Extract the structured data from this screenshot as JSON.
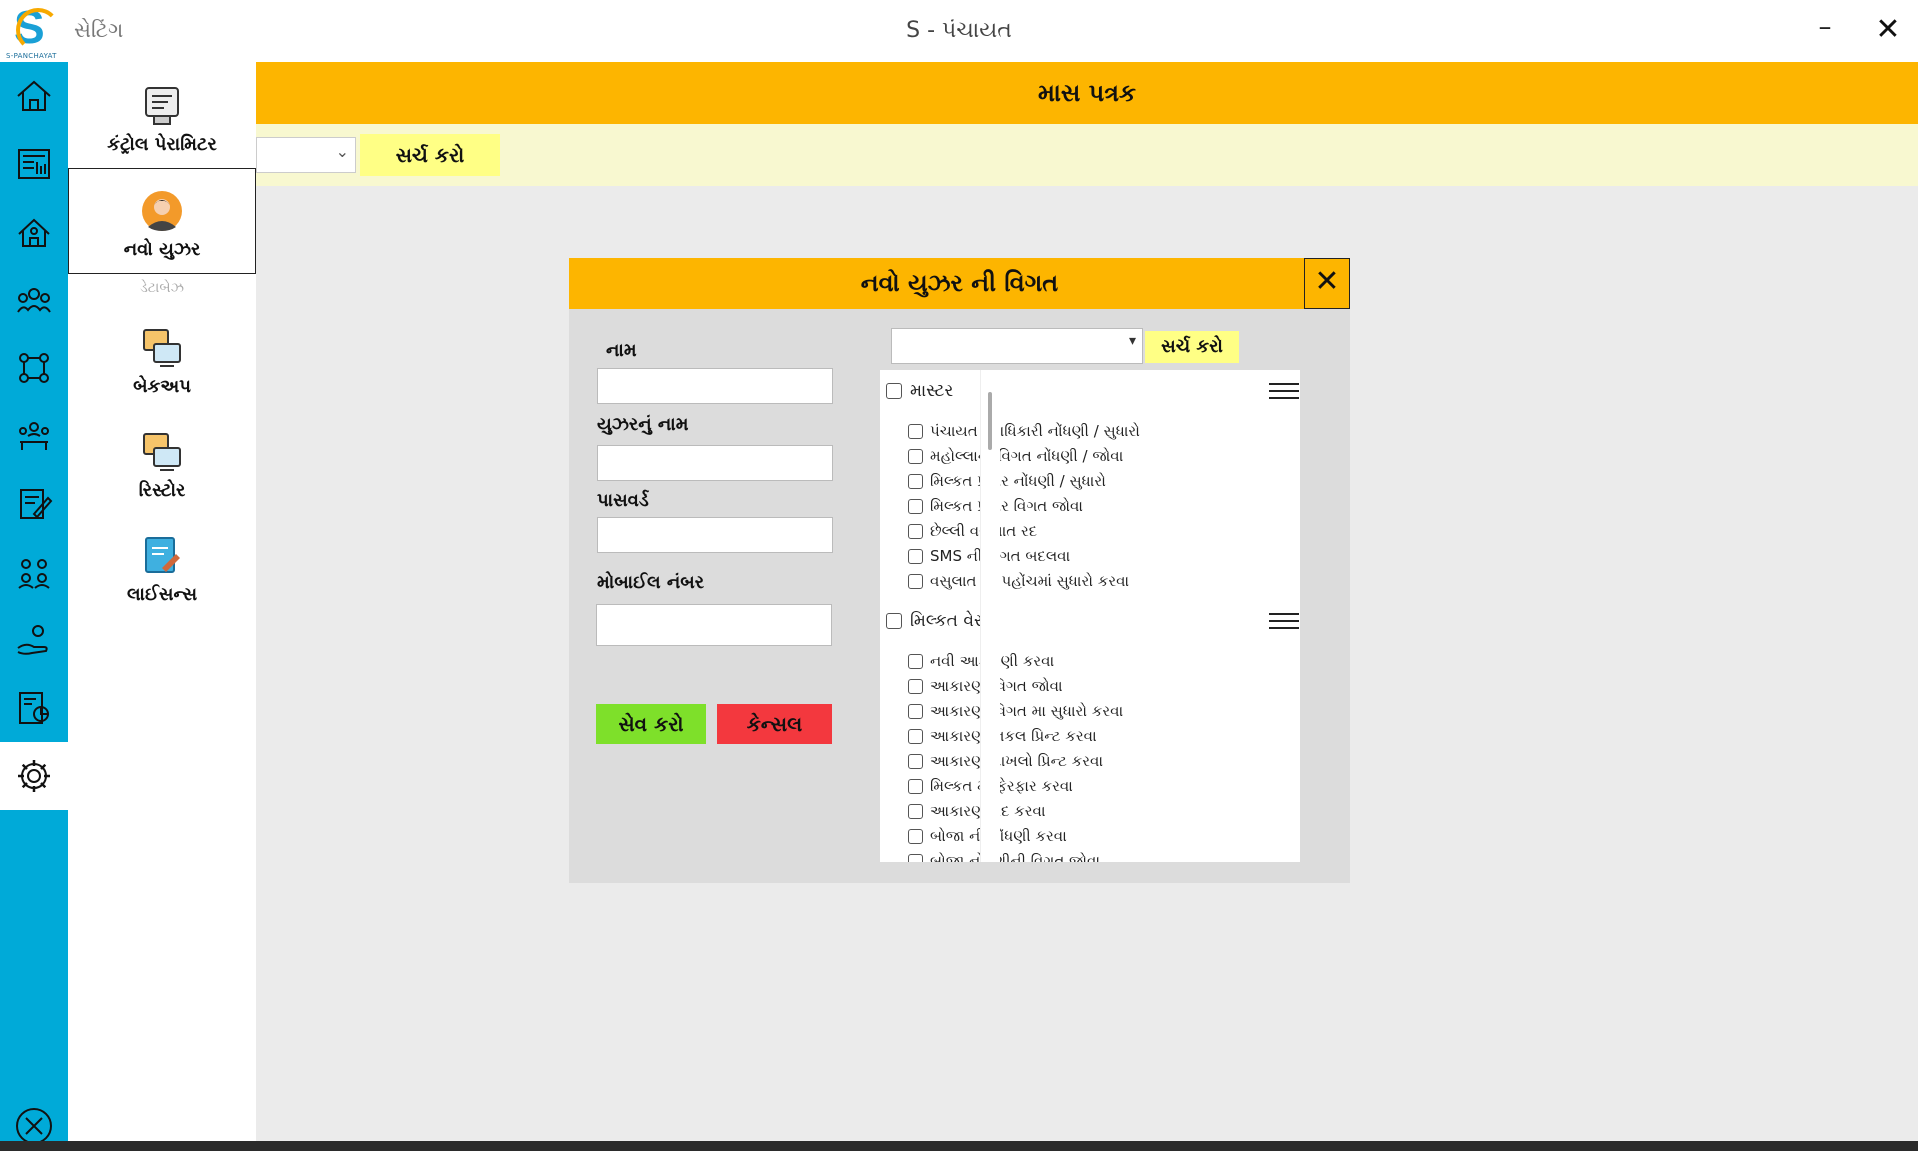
{
  "app": {
    "logo_letter": "S",
    "logo_caption": "S-PANCHAYAT",
    "section_title": "સેટિંગ",
    "window_title": "S - પંચાયત",
    "minimize_label": "–",
    "close_label": "✕"
  },
  "rail": {
    "items": [
      "home-icon",
      "dashboard-icon",
      "property-icon",
      "people-group-icon",
      "settings-tree-icon",
      "team-icon",
      "edit-document-icon",
      "users-icon",
      "hand-care-icon",
      "report-icon",
      "gear-icon"
    ],
    "exit_icon": "exit-circle-icon"
  },
  "submenu": {
    "items": [
      {
        "label": "કંટ્રોલ પેરામિટર",
        "icon": "control-parameter-icon"
      },
      {
        "label": "નવો યુઝર",
        "icon": "user-avatar-icon"
      },
      {
        "label": "બેકઅપ",
        "icon": "backup-icon"
      },
      {
        "label": "રિસ્ટોર",
        "icon": "restore-icon"
      },
      {
        "label": "લાઈસન્સ",
        "icon": "license-icon"
      }
    ],
    "database_label": "ડેટાબેઝ"
  },
  "main": {
    "header": "માસ પત્રક",
    "search_label": "સર્ચ કરો"
  },
  "modal": {
    "title": "નવો યુઝર ની વિગત",
    "close_label": "✕",
    "fields": {
      "name_label": "નામ",
      "username_label": "યુઝરનું નામ",
      "password_label": "પાસવર્ડ",
      "mobile_label": "મોબાઈલ નંબર"
    },
    "save_label": "સેવ કરો",
    "cancel_label": "કેન્સલ",
    "search_label": "સર્ચ કરો",
    "groups": [
      {
        "label": "માસ્ટર",
        "items": [
          "પંચાયત પદાધિકારી નોંધણી / સુધારો",
          "મહોલ્લાની વિગત નોંધણી / જોવા",
          "મિલ્કત પ્રકાર નોંધણી / સુધારો",
          "મિલ્કત પ્રકાર વિગત જોવા",
          "છેલ્લી વસુલાત રદ",
          "SMS ની વિગત બદલવા",
          "વસુલાત ની પહોંચમાં સુધારો કરવા"
        ]
      },
      {
        "label": "મિલ્કત વેરા",
        "items": [
          "નવી આકારણી કરવા",
          "આકારણી વિગત જોવા",
          "આકારણી વિગત મા સુધારો કરવા",
          "આકારણી નકલ પ્રિન્ટ કરવા",
          "આકારણી દાખલો પ્રિન્ટ કરવા",
          "મિલ્કત મા ફેરફાર કરવા",
          "આકારણી રદ કરવા",
          "બોજા ની નોંધણી કરવા",
          "બોજા નોંધણીની વિગત જોવા"
        ]
      }
    ]
  }
}
